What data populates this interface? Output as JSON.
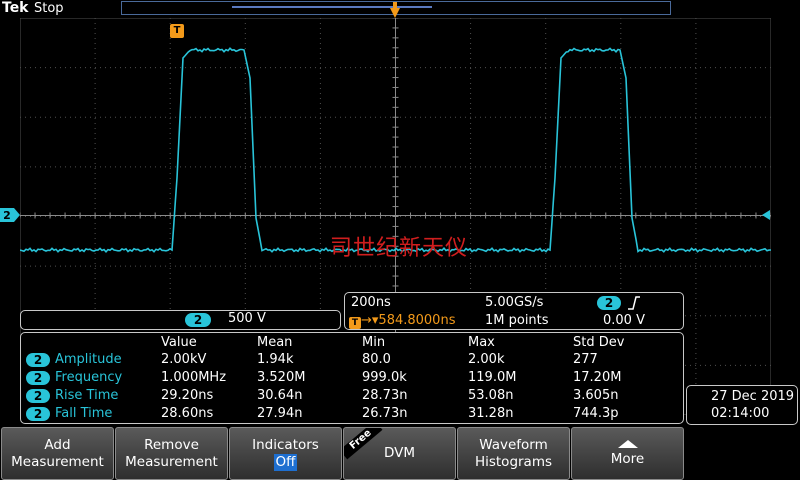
{
  "header": {
    "brand": "Tek",
    "run_state": "Stop"
  },
  "colors": {
    "channel2": "#29c4d9",
    "trigger": "#f39a1a",
    "graticule": "#4f4f4f",
    "watermark": "#d01e1e"
  },
  "markers": {
    "channel": "2",
    "trigger": "T"
  },
  "watermark": "司世纪新天仪",
  "channel": {
    "number": "2",
    "scale": "500 V"
  },
  "horizontal": {
    "timebase": "200ns",
    "sample_rate": "5.00GS/s",
    "position": "584.8000ns",
    "record_length": "1M points",
    "trigger_source": "2",
    "trigger_level": "0.00 V"
  },
  "measurements": {
    "headers": [
      "Value",
      "Mean",
      "Min",
      "Max",
      "Std Dev"
    ],
    "rows": [
      {
        "ch": "2",
        "name": "Amplitude",
        "value": "2.00kV",
        "mean": "1.94k",
        "min": "80.0",
        "max": "2.00k",
        "std": "277"
      },
      {
        "ch": "2",
        "name": "Frequency",
        "value": "1.000MHz",
        "mean": "3.520M",
        "min": "999.0k",
        "max": "119.0M",
        "std": "17.20M"
      },
      {
        "ch": "2",
        "name": "Rise Time",
        "value": "29.20ns",
        "mean": "30.64n",
        "min": "28.73n",
        "max": "53.08n",
        "std": "3.605n"
      },
      {
        "ch": "2",
        "name": "Fall Time",
        "value": "28.60ns",
        "mean": "27.94n",
        "min": "26.73n",
        "max": "31.28n",
        "std": "744.3p"
      }
    ]
  },
  "datetime": {
    "date": "27 Dec  2019",
    "time": "02:14:00"
  },
  "softkeys": [
    {
      "line1": "Add",
      "line2": "Measurement"
    },
    {
      "line1": "Remove",
      "line2": "Measurement"
    },
    {
      "line1": "Indicators",
      "line2": "Off"
    },
    {
      "line1": "DVM",
      "tag": "Free"
    },
    {
      "line1": "Waveform",
      "line2": "Histograms"
    },
    {
      "line1": "More"
    }
  ]
}
